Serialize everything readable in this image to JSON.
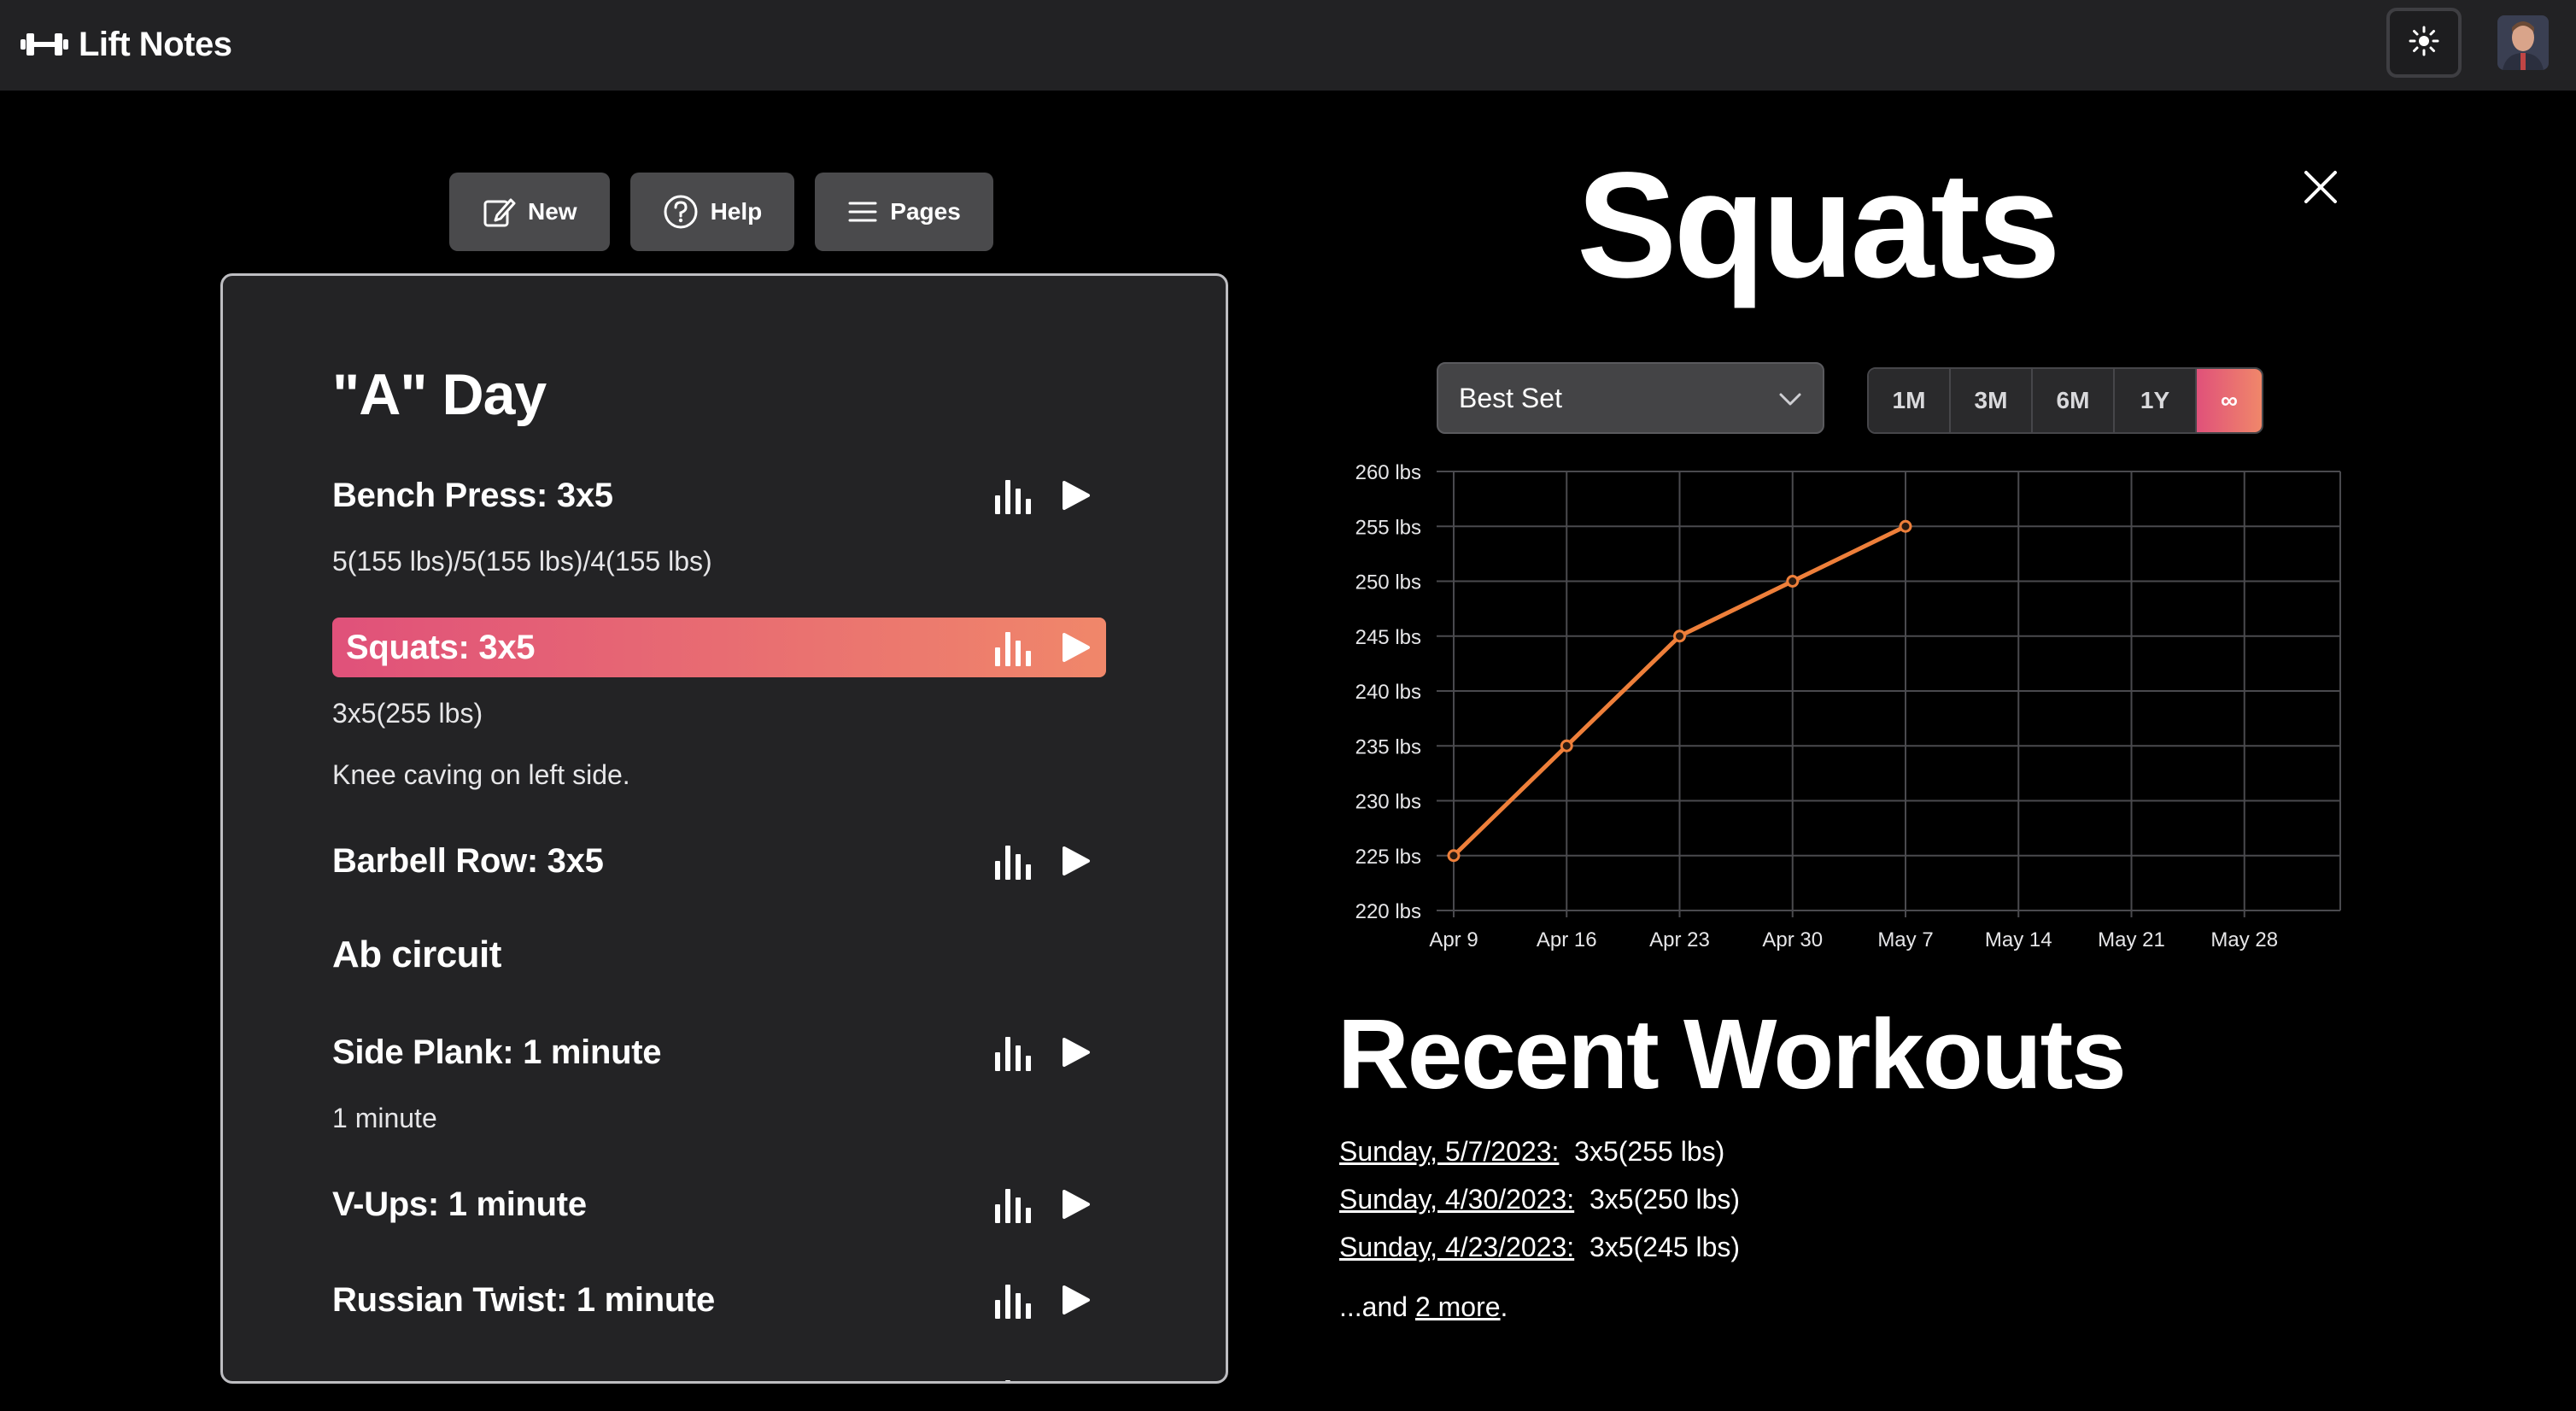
{
  "app": {
    "name": "Lift Notes"
  },
  "toolbar": {
    "new_label": "New",
    "help_label": "Help",
    "pages_label": "Pages"
  },
  "notes": {
    "day_heading": "\"A\" Day",
    "section_heading": "Ab circuit",
    "exercises": [
      {
        "label": "Bench Press: 3x5"
      },
      {
        "label": "Squats: 3x5"
      },
      {
        "label": "Barbell Row: 3x5"
      },
      {
        "label": "Side Plank: 1 minute"
      },
      {
        "label": "V-Ups: 1 minute"
      },
      {
        "label": "Russian Twist: 1 minute"
      }
    ],
    "details": {
      "bench": "5(155 lbs)/5(155 lbs)/4(155 lbs)",
      "squats_sets": "3x5(255 lbs)",
      "squats_note": "Knee caving on left side.",
      "plank": "1 minute"
    }
  },
  "detail": {
    "title": "Squats",
    "metric_select": "Best Set",
    "ranges": [
      "1M",
      "3M",
      "6M",
      "1Y",
      "∞"
    ],
    "active_range": "∞",
    "recent_title": "Recent Workouts",
    "recent": [
      {
        "date": "Sunday, 5/7/2023:",
        "value": "3x5(255 lbs)"
      },
      {
        "date": "Sunday, 4/30/2023:",
        "value": "3x5(250 lbs)"
      },
      {
        "date": "Sunday, 4/23/2023:",
        "value": "3x5(245 lbs)"
      }
    ],
    "more_prefix": "...and ",
    "more_link": "2 more",
    "more_suffix": "."
  },
  "colors": {
    "accent_start": "#e0517a",
    "accent_end": "#f0876a",
    "line": "#ee7f3a"
  },
  "chart_data": {
    "type": "line",
    "title": "",
    "xlabel": "",
    "ylabel": "",
    "x_ticks": [
      "Apr 9",
      "Apr 16",
      "Apr 23",
      "Apr 30",
      "May 7",
      "May 14",
      "May 21",
      "May 28"
    ],
    "y_ticks": [
      "220 lbs",
      "225 lbs",
      "230 lbs",
      "235 lbs",
      "240 lbs",
      "245 lbs",
      "250 lbs",
      "255 lbs",
      "260 lbs"
    ],
    "ylim": [
      220,
      260
    ],
    "grid": true,
    "legend": "none",
    "series": [
      {
        "x": [
          "Apr 9",
          "Apr 16",
          "Apr 23",
          "Apr 30",
          "May 7"
        ],
        "y": [
          225,
          235,
          245,
          250,
          255
        ]
      }
    ]
  }
}
